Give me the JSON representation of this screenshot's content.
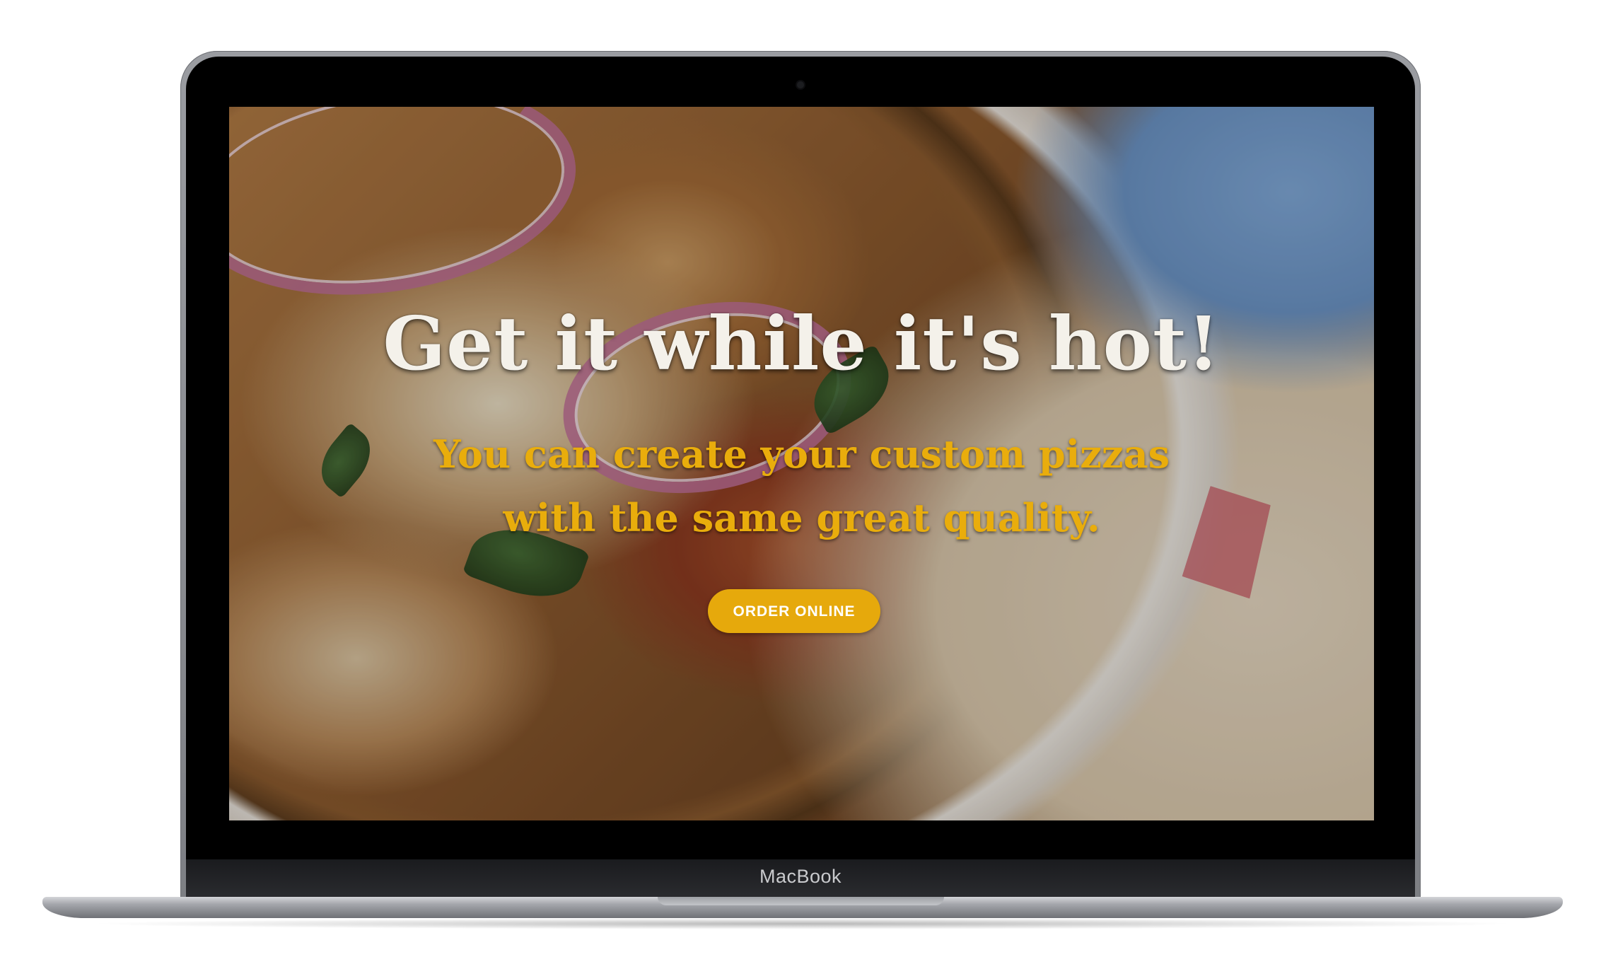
{
  "device": {
    "brand_label": "MacBook"
  },
  "hero": {
    "title": "Get it while it's hot!",
    "subtitle_line1": "You can create your custom pizzas",
    "subtitle_line2": "with the same great quality.",
    "cta_label": "ORDER ONLINE"
  },
  "colors": {
    "accent": "#e6a90c",
    "title_text": "#f4f1ea",
    "subtitle_text": "#e9ad0c"
  },
  "background": {
    "image_subject": "pizza-photo"
  }
}
